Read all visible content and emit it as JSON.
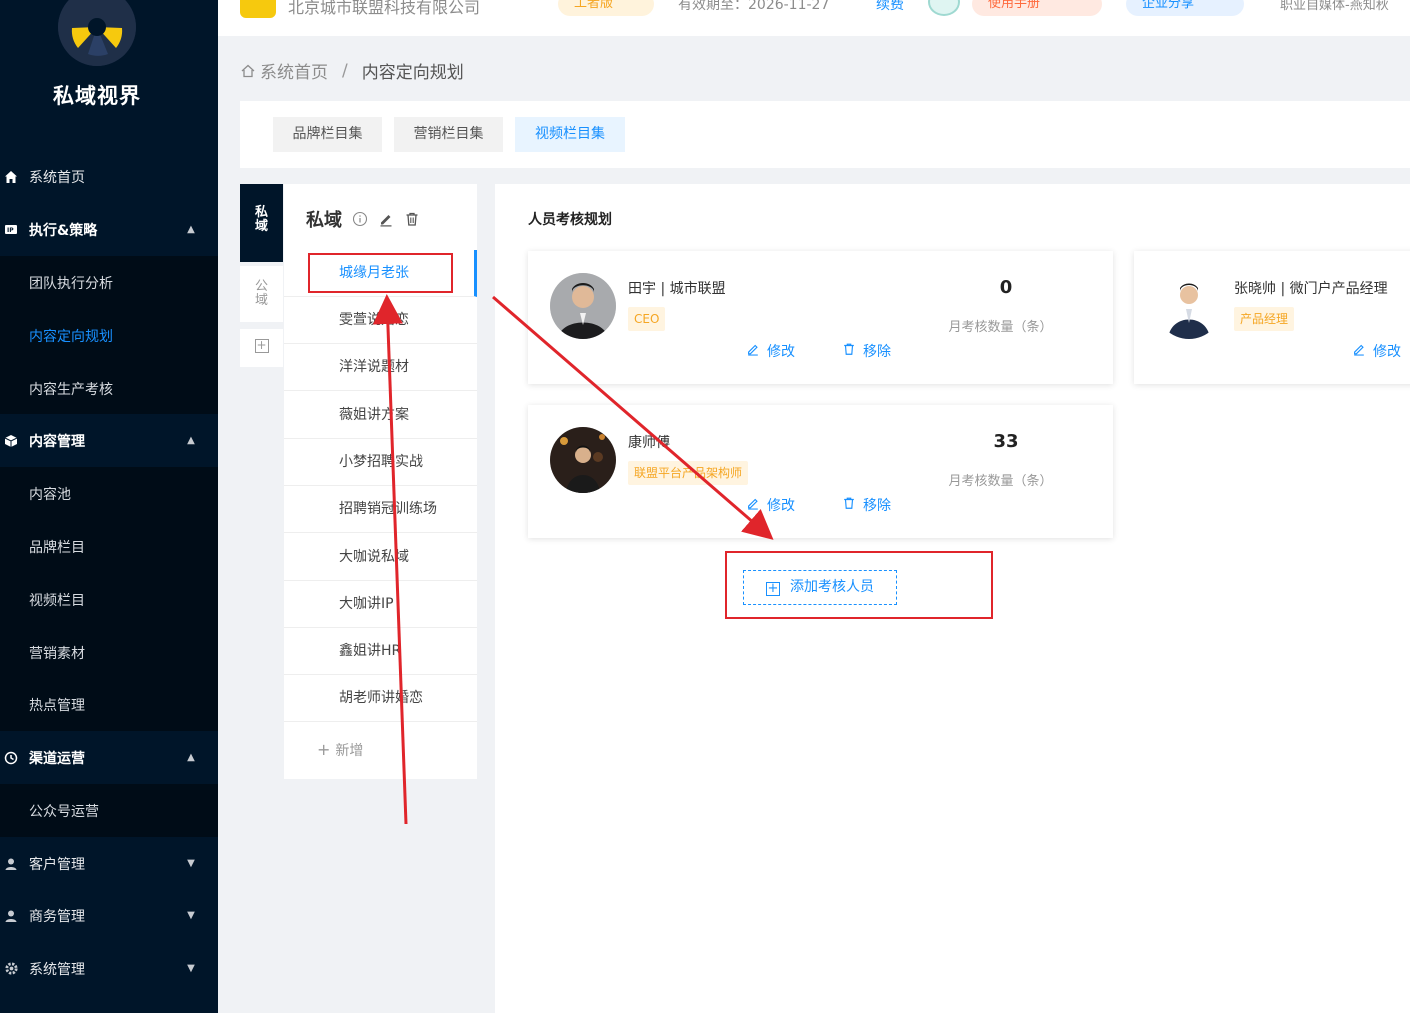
{
  "sidebar": {
    "brand": "私域视界",
    "items": [
      {
        "label": "系统首页",
        "icon": "home-icon",
        "type": "group"
      },
      {
        "label": "执行&策略",
        "icon": "ip-icon",
        "type": "group-open"
      },
      {
        "label": "团队执行分析",
        "type": "sub"
      },
      {
        "label": "内容定向规划",
        "type": "sub-active"
      },
      {
        "label": "内容生产考核",
        "type": "sub"
      },
      {
        "label": "内容管理",
        "icon": "cube-icon",
        "type": "group-open"
      },
      {
        "label": "内容池",
        "type": "sub"
      },
      {
        "label": "品牌栏目",
        "type": "sub"
      },
      {
        "label": "视频栏目",
        "type": "sub"
      },
      {
        "label": "营销素材",
        "type": "sub"
      },
      {
        "label": "热点管理",
        "type": "sub"
      },
      {
        "label": "渠道运营",
        "icon": "clock-icon",
        "type": "group-open"
      },
      {
        "label": "公众号运营",
        "type": "sub"
      },
      {
        "label": "客户管理",
        "icon": "users-icon",
        "type": "group"
      },
      {
        "label": "商务管理",
        "icon": "users-icon",
        "type": "group"
      },
      {
        "label": "系统管理",
        "icon": "gear-icon",
        "type": "group"
      }
    ]
  },
  "header": {
    "company": "北京城市联盟科技有限公司",
    "version": "工者版",
    "expire": "有效期至：2026-11-27",
    "renew": "续费",
    "manual": "使用手册",
    "share": "企业分享",
    "user": "职业自媒体-燕知秋"
  },
  "breadcrumb": {
    "home": "系统首页",
    "separator": "/",
    "current": "内容定向规划"
  },
  "tabs": [
    "品牌栏目集",
    "营销栏目集",
    "视频栏目集"
  ],
  "active_tab": "视频栏目集",
  "vertical_tabs": {
    "private_label": [
      "私",
      "域"
    ],
    "public_label": [
      "公",
      "域"
    ]
  },
  "column_list": {
    "title": "私域",
    "items": [
      "城缘月老张",
      "雯萱说婚恋",
      "洋洋说题材",
      "薇姐讲方案",
      "小梦招聘实战",
      "招聘销冠训练场",
      "大咖说私域",
      "大咖讲IP",
      "鑫姐讲HR",
      "胡老师讲婚恋"
    ],
    "active": "城缘月老张",
    "add_label": "新增"
  },
  "main": {
    "section_title": "人员考核规划",
    "count_label": "月考核数量（条）",
    "edit_label": "修改",
    "remove_label": "移除",
    "add_button": "添加考核人员",
    "people": [
      {
        "name": "田宇 | 城市联盟",
        "tag": "CEO",
        "count": "0"
      },
      {
        "name": "张晓帅 | 微门户产品经理",
        "tag": "产品经理",
        "count": ""
      },
      {
        "name": "康师傅",
        "tag": "联盟平台产品架构师",
        "count": "33"
      }
    ]
  },
  "colors": {
    "sidebar_bg": "#001529",
    "accent": "#1890ff",
    "tag_orange": "#f5a623",
    "annotation_red": "#e0252b"
  }
}
